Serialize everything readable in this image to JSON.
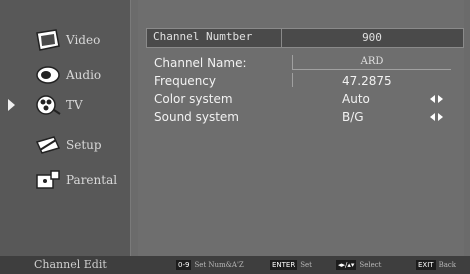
{
  "sidebar": {
    "items": [
      {
        "label": "Video",
        "icon": "video-icon"
      },
      {
        "label": "Audio",
        "icon": "audio-icon"
      },
      {
        "label": "TV",
        "icon": "tv-icon",
        "selected": true
      },
      {
        "label": "Setup",
        "icon": "setup-icon"
      },
      {
        "label": "Parental",
        "icon": "parental-icon"
      }
    ]
  },
  "main": {
    "header": {
      "label": "Channel Numtber",
      "value": "900"
    },
    "rows": [
      {
        "label": "Channel Name:",
        "value": "ARD"
      },
      {
        "label": "Frequency",
        "value": "47.2875"
      },
      {
        "label": "Color system",
        "value": "Auto"
      },
      {
        "label": "Sound system",
        "value": "B/G"
      }
    ]
  },
  "footer": {
    "title": "Channel Edit",
    "hints": [
      {
        "key": "0-9",
        "text": "Set Num&A'Z"
      },
      {
        "key": "ENTER",
        "text": "Set"
      },
      {
        "key": "◂▸/▴▾",
        "text": "Select"
      },
      {
        "key": "EXIT",
        "text": "Back"
      }
    ]
  },
  "colors": {
    "background": "#6b6b6b",
    "sidebar": "#585858",
    "footer": "#3e3e3e",
    "text": "#f2f2f2"
  }
}
